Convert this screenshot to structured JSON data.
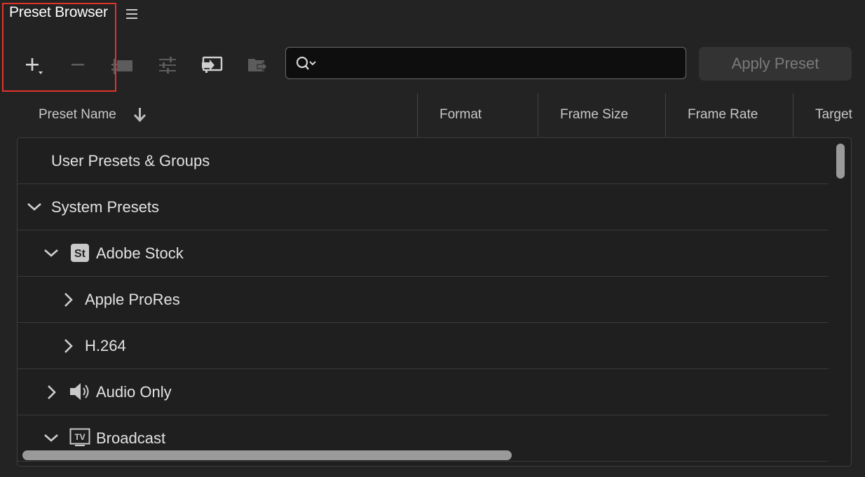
{
  "panel": {
    "title": "Preset Browser",
    "menu_icon": "hamburger-menu-icon"
  },
  "toolbar": {
    "buttons": [
      {
        "name": "new-preset-button",
        "icon": "plus-dropdown-icon",
        "enabled": true
      },
      {
        "name": "remove-preset-button",
        "icon": "minus-icon",
        "enabled": false
      },
      {
        "name": "group-presets-button",
        "icon": "folder-group-icon",
        "enabled": false
      },
      {
        "name": "preset-settings-button",
        "icon": "sliders-icon",
        "enabled": false
      },
      {
        "name": "import-presets-button",
        "icon": "import-icon",
        "enabled": true
      },
      {
        "name": "export-presets-button",
        "icon": "export-icon",
        "enabled": false
      }
    ],
    "search": {
      "value": "",
      "placeholder": "",
      "icon": "search-dropdown-icon"
    },
    "apply_label": "Apply Preset"
  },
  "columns": [
    {
      "label": "Preset Name",
      "sort": "descending",
      "sort_icon": "arrow-down-icon"
    },
    {
      "label": "Format"
    },
    {
      "label": "Frame Size"
    },
    {
      "label": "Frame Rate"
    },
    {
      "label": "Target"
    }
  ],
  "rows": [
    {
      "label": "User Presets & Groups",
      "level": 0,
      "expander": "none"
    },
    {
      "label": "System Presets",
      "level": 0,
      "expander": "expanded"
    },
    {
      "label": "Adobe Stock",
      "level": 1,
      "expander": "expanded",
      "icon": "adobe-stock-icon",
      "badge": "St"
    },
    {
      "label": "Apple ProRes",
      "level": 2,
      "expander": "collapsed"
    },
    {
      "label": "H.264",
      "level": 2,
      "expander": "collapsed"
    },
    {
      "label": "Audio Only",
      "level": 1,
      "expander": "collapsed",
      "icon": "speaker-icon"
    },
    {
      "label": "Broadcast",
      "level": 1,
      "expander": "expanded",
      "icon": "tv-icon",
      "badge": "TV"
    }
  ],
  "colors": {
    "background": "#232323",
    "highlight": "#e0342a",
    "text": "#e2e2e2",
    "disabled": "#7a7a7a"
  }
}
